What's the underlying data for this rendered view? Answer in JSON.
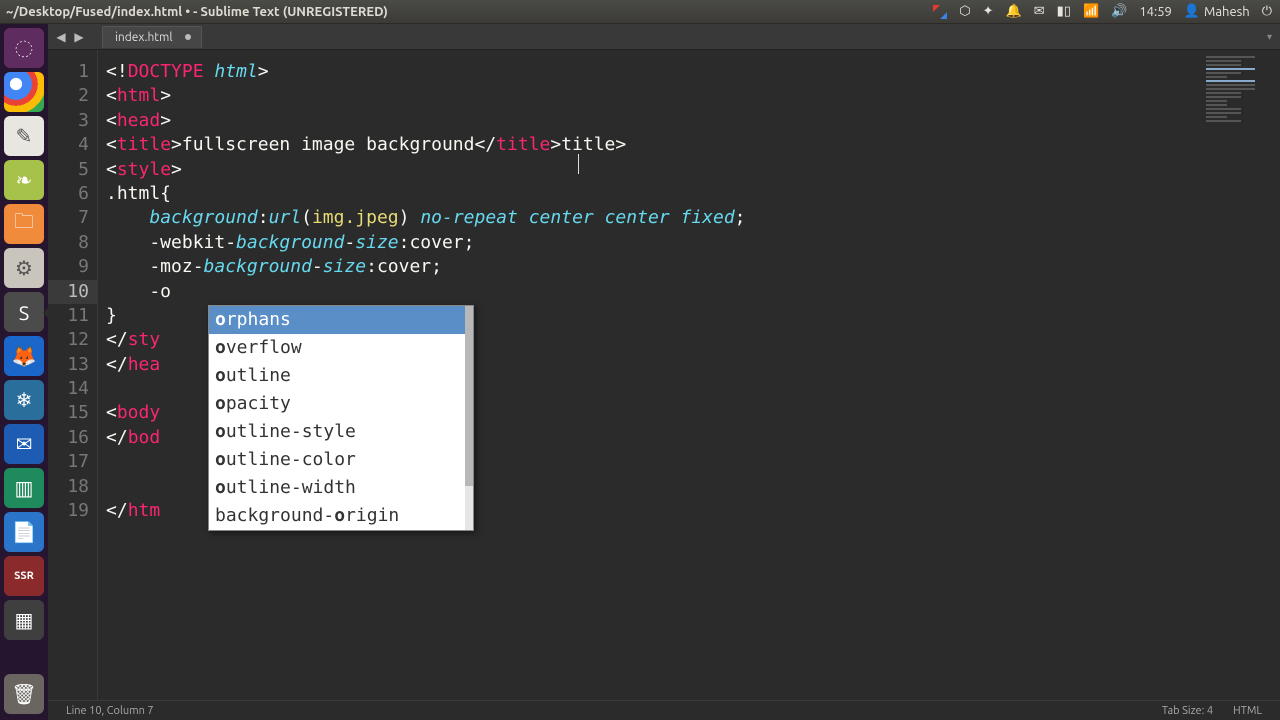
{
  "menubar": {
    "window_title": "~/Desktop/Fused/index.html • - Sublime Text (UNREGISTERED)",
    "time": "14:59",
    "user": "Mahesh"
  },
  "launcher": {
    "items": [
      {
        "name": "dash",
        "glyph": "◌"
      },
      {
        "name": "chrome",
        "glyph": ""
      },
      {
        "name": "text-editor",
        "glyph": "✎"
      },
      {
        "name": "midori",
        "glyph": "❧"
      },
      {
        "name": "files",
        "glyph": "🗀"
      },
      {
        "name": "settings",
        "glyph": "⚙"
      },
      {
        "name": "sublime",
        "glyph": "S"
      },
      {
        "name": "firefox",
        "glyph": "🦊"
      },
      {
        "name": "iceweasel",
        "glyph": "❄"
      },
      {
        "name": "thunderbird",
        "glyph": "✉"
      },
      {
        "name": "libreoffice",
        "glyph": "▥"
      },
      {
        "name": "writer",
        "glyph": "📄"
      },
      {
        "name": "ssr",
        "glyph": "SSR"
      },
      {
        "name": "workspaces",
        "glyph": "▦"
      }
    ],
    "trash": {
      "glyph": "🗑"
    }
  },
  "tabs": {
    "open": [
      {
        "label": "index.html",
        "dirty": true
      }
    ]
  },
  "code": {
    "lines": [
      {
        "n": 1,
        "segs": [
          {
            "t": "<!",
            "c": "p"
          },
          {
            "t": "DOCTYPE",
            "c": "tag"
          },
          {
            "t": " ",
            "c": "p"
          },
          {
            "t": "html",
            "c": "attr ital"
          },
          {
            "t": ">",
            "c": "p"
          }
        ]
      },
      {
        "n": 2,
        "segs": [
          {
            "t": "<",
            "c": "p"
          },
          {
            "t": "html",
            "c": "tag"
          },
          {
            "t": ">",
            "c": "p"
          }
        ]
      },
      {
        "n": 3,
        "segs": [
          {
            "t": "<",
            "c": "p"
          },
          {
            "t": "head",
            "c": "tag"
          },
          {
            "t": ">",
            "c": "p"
          }
        ]
      },
      {
        "n": 4,
        "segs": [
          {
            "t": "<",
            "c": "p"
          },
          {
            "t": "title",
            "c": "tag"
          },
          {
            "t": ">",
            "c": "p"
          },
          {
            "t": "fullscreen image background",
            "c": "txt"
          },
          {
            "t": "</",
            "c": "p"
          },
          {
            "t": "title",
            "c": "tag"
          },
          {
            "t": ">",
            "c": "p"
          },
          {
            "t": "title>",
            "c": "txt"
          }
        ]
      },
      {
        "n": 5,
        "segs": [
          {
            "t": "<",
            "c": "p"
          },
          {
            "t": "style",
            "c": "tag"
          },
          {
            "t": ">",
            "c": "p"
          }
        ]
      },
      {
        "n": 6,
        "segs": [
          {
            "t": ".html{",
            "c": "txt"
          }
        ]
      },
      {
        "n": 7,
        "segs": [
          {
            "t": "    ",
            "c": "p"
          },
          {
            "t": "background",
            "c": "kw"
          },
          {
            "t": ":",
            "c": "p"
          },
          {
            "t": "url",
            "c": "kw"
          },
          {
            "t": "(",
            "c": "p"
          },
          {
            "t": "img.jpeg",
            "c": "str"
          },
          {
            "t": ") ",
            "c": "p"
          },
          {
            "t": "no-repeat",
            "c": "kw"
          },
          {
            "t": " ",
            "c": "p"
          },
          {
            "t": "center",
            "c": "kw"
          },
          {
            "t": " ",
            "c": "p"
          },
          {
            "t": "center",
            "c": "kw"
          },
          {
            "t": " ",
            "c": "p"
          },
          {
            "t": "fixed",
            "c": "kw"
          },
          {
            "t": ";",
            "c": "p"
          }
        ]
      },
      {
        "n": 8,
        "segs": [
          {
            "t": "    -webkit-",
            "c": "txt"
          },
          {
            "t": "background",
            "c": "kw"
          },
          {
            "t": "-",
            "c": "p"
          },
          {
            "t": "size",
            "c": "kw ital"
          },
          {
            "t": ":cover;",
            "c": "txt"
          }
        ]
      },
      {
        "n": 9,
        "segs": [
          {
            "t": "    -moz-",
            "c": "txt"
          },
          {
            "t": "background",
            "c": "kw"
          },
          {
            "t": "-",
            "c": "p"
          },
          {
            "t": "size",
            "c": "kw ital"
          },
          {
            "t": ":cover;",
            "c": "txt"
          }
        ]
      },
      {
        "n": 10,
        "current": true,
        "segs": [
          {
            "t": "    -o",
            "c": "txt"
          }
        ]
      },
      {
        "n": 11,
        "segs": [
          {
            "t": "}",
            "c": "txt"
          }
        ]
      },
      {
        "n": 12,
        "segs": [
          {
            "t": "</",
            "c": "p"
          },
          {
            "t": "sty",
            "c": "tag"
          }
        ]
      },
      {
        "n": 13,
        "segs": [
          {
            "t": "</",
            "c": "p"
          },
          {
            "t": "hea",
            "c": "tag"
          }
        ]
      },
      {
        "n": 14,
        "segs": []
      },
      {
        "n": 15,
        "segs": [
          {
            "t": "<",
            "c": "p"
          },
          {
            "t": "body",
            "c": "tag"
          }
        ]
      },
      {
        "n": 16,
        "segs": [
          {
            "t": "</",
            "c": "p"
          },
          {
            "t": "bod",
            "c": "tag"
          }
        ]
      },
      {
        "n": 17,
        "segs": []
      },
      {
        "n": 18,
        "segs": []
      },
      {
        "n": 19,
        "segs": [
          {
            "t": "</",
            "c": "p"
          },
          {
            "t": "htm",
            "c": "tag"
          }
        ]
      }
    ]
  },
  "autocomplete": {
    "query": "o",
    "items": [
      {
        "pre": "o",
        "rest": "rphans",
        "selected": true
      },
      {
        "pre": "o",
        "rest": "verflow"
      },
      {
        "pre": "o",
        "rest": "utline"
      },
      {
        "pre": "o",
        "rest": "pacity"
      },
      {
        "pre": "o",
        "rest": "utline-style"
      },
      {
        "pre": "o",
        "rest": "utline-color"
      },
      {
        "pre": "o",
        "rest": "utline-width"
      },
      {
        "prefix": "background-",
        "pre": "o",
        "rest": "rigin"
      }
    ]
  },
  "statusbar": {
    "position": "Line 10, Column 7",
    "tab_size": "Tab Size: 4",
    "syntax": "HTML"
  }
}
